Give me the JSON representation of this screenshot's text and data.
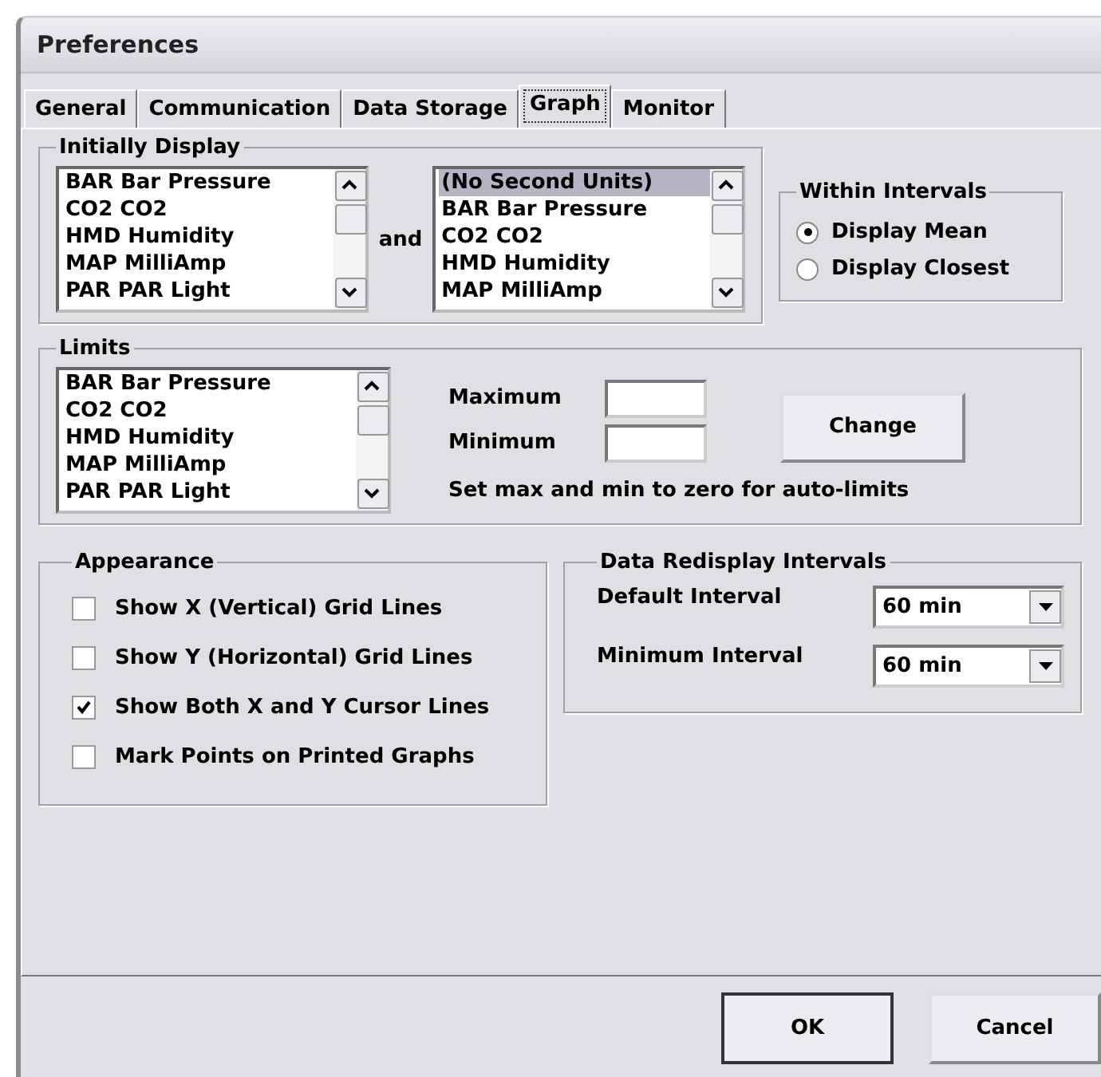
{
  "window": {
    "title": "Preferences"
  },
  "tabs": [
    {
      "label": "General",
      "selected": false
    },
    {
      "label": "Communication",
      "selected": false
    },
    {
      "label": "Data Storage",
      "selected": false
    },
    {
      "label": "Graph",
      "selected": true
    },
    {
      "label": "Monitor",
      "selected": false
    }
  ],
  "initially_display": {
    "title": "Initially Display",
    "joiner": "and",
    "primary_list": [
      {
        "label": "BAR Bar Pressure",
        "selected": false
      },
      {
        "label": "CO2 CO2",
        "selected": false
      },
      {
        "label": "HMD Humidity",
        "selected": false
      },
      {
        "label": "MAP MilliAmp",
        "selected": false
      },
      {
        "label": "PAR PAR Light",
        "selected": false
      }
    ],
    "secondary_list": [
      {
        "label": "(No Second Units)",
        "selected": true
      },
      {
        "label": "BAR Bar Pressure",
        "selected": false
      },
      {
        "label": "CO2 CO2",
        "selected": false
      },
      {
        "label": "HMD Humidity",
        "selected": false
      },
      {
        "label": "MAP MilliAmp",
        "selected": false
      }
    ]
  },
  "within_intervals": {
    "title": "Within Intervals",
    "options": [
      {
        "label": "Display Mean",
        "selected": true
      },
      {
        "label": "Display Closest",
        "selected": false
      }
    ]
  },
  "limits": {
    "title": "Limits",
    "list": [
      {
        "label": "BAR Bar Pressure",
        "selected": false
      },
      {
        "label": "CO2 CO2",
        "selected": false
      },
      {
        "label": "HMD Humidity",
        "selected": false
      },
      {
        "label": "MAP MilliAmp",
        "selected": false
      },
      {
        "label": "PAR PAR Light",
        "selected": false
      }
    ],
    "fields": [
      {
        "label": "Maximum"
      },
      {
        "label": "Minimum"
      }
    ],
    "button": "Change",
    "hint": "Set max and min to zero for auto-limits"
  },
  "appearance": {
    "title": "Appearance",
    "options": [
      {
        "label": "Show X (Vertical) Grid Lines",
        "checked": false
      },
      {
        "label": "Show Y (Horizontal) Grid Lines",
        "checked": false
      },
      {
        "label": "Show Both X and Y Cursor Lines",
        "checked": true
      },
      {
        "label": "Mark Points on Printed Graphs",
        "checked": false
      }
    ]
  },
  "data_redisplay_intervals": {
    "title": "Data Redisplay Intervals",
    "fields": [
      {
        "label": "Default Interval",
        "value": "60 min"
      },
      {
        "label": "Minimum Interval",
        "value": "60 min"
      }
    ]
  },
  "buttons": [
    "OK",
    "Cancel"
  ]
}
